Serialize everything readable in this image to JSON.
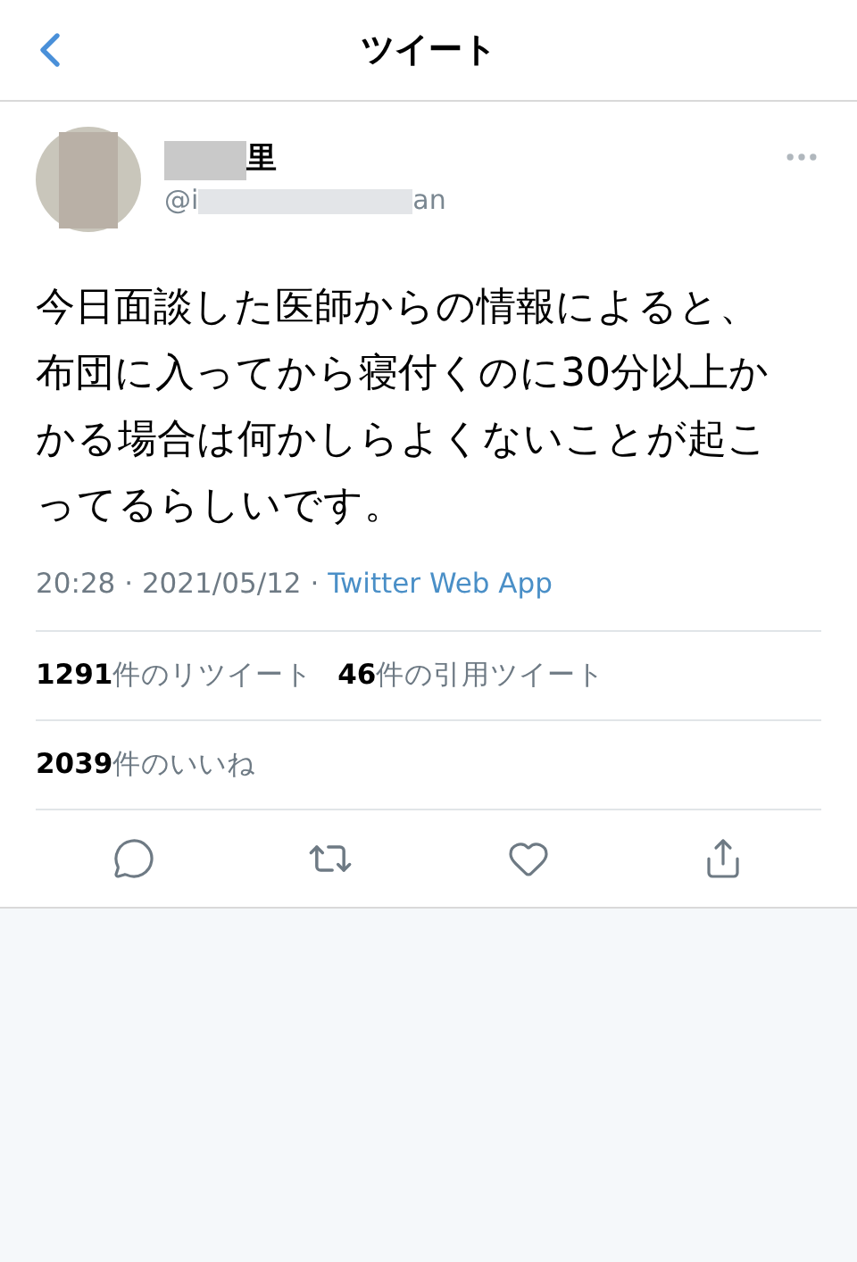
{
  "header": {
    "title": "ツイート"
  },
  "author": {
    "name_end": "里",
    "handle_start": "@i",
    "handle_end": "an"
  },
  "tweet": {
    "text": "今日面談した医師からの情報によると、布団に入ってから寝付くのに30分以上かかる場合は何かしらよくないことが起こってるらしいです。",
    "time": "20:28 · 2021/05/12 · ",
    "source": "Twitter Web App"
  },
  "stats": [
    {
      "count": "1291",
      "label": "件のリツイート"
    },
    {
      "count": "46",
      "label": "件の引用ツイート"
    }
  ],
  "likes": {
    "count": "2039",
    "label": "件のいいね"
  }
}
